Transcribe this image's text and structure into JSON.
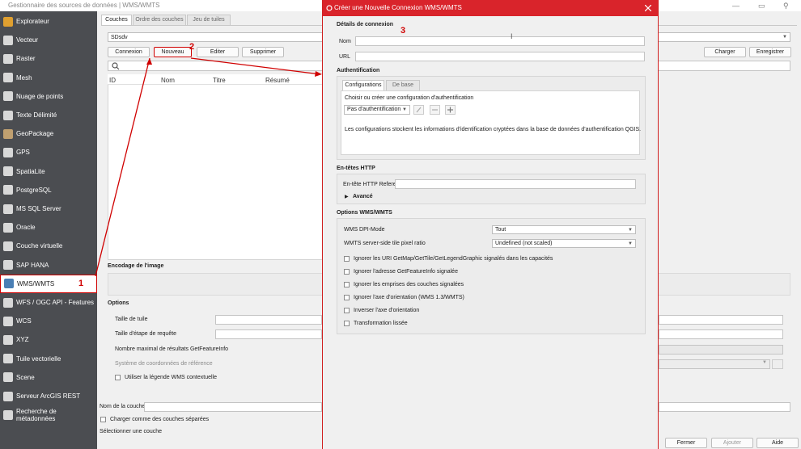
{
  "window": {
    "title": "Gestionnaire des sources de données | WMS/WMTS",
    "min": "—",
    "max": "▭",
    "pin": "⚲"
  },
  "sidebar": {
    "items": [
      {
        "label": "Explorateur",
        "icon": "folder-icon"
      },
      {
        "label": "Vecteur",
        "icon": "vector-icon"
      },
      {
        "label": "Raster",
        "icon": "raster-icon"
      },
      {
        "label": "Mesh",
        "icon": "mesh-icon"
      },
      {
        "label": "Nuage de points",
        "icon": "point-cloud-icon"
      },
      {
        "label": "Texte Délimité",
        "icon": "delimited-text-icon"
      },
      {
        "label": "GeoPackage",
        "icon": "geopackage-icon"
      },
      {
        "label": "GPS",
        "icon": "gps-icon"
      },
      {
        "label": "SpatiaLite",
        "icon": "spatialite-icon"
      },
      {
        "label": "PostgreSQL",
        "icon": "postgresql-icon"
      },
      {
        "label": "MS SQL Server",
        "icon": "mssql-icon"
      },
      {
        "label": "Oracle",
        "icon": "oracle-icon"
      },
      {
        "label": "Couche virtuelle",
        "icon": "virtual-layer-icon"
      },
      {
        "label": "SAP HANA",
        "icon": "sap-hana-icon"
      },
      {
        "label": "WMS/WMTS",
        "icon": "wms-icon"
      },
      {
        "label": "WFS / OGC API - Features",
        "icon": "wfs-icon"
      },
      {
        "label": "WCS",
        "icon": "wcs-icon"
      },
      {
        "label": "XYZ",
        "icon": "xyz-icon"
      },
      {
        "label": "Tuile vectorielle",
        "icon": "vector-tile-icon"
      },
      {
        "label": "Scene",
        "icon": "scene-icon"
      },
      {
        "label": "Serveur ArcGIS REST",
        "icon": "arcgis-icon"
      },
      {
        "label": "Recherche de métadonnées",
        "icon": "metadata-search-icon"
      }
    ]
  },
  "main": {
    "tabs": [
      "Couches",
      "Ordre des couches",
      "Jeu de tuiles"
    ],
    "connection_value": "SDsdv",
    "buttons": {
      "connexion": "Connexion",
      "nouveau": "Nouveau",
      "editer": "Editer",
      "supprimer": "Supprimer",
      "charger": "Charger",
      "enregistrer": "Enregistrer"
    },
    "columns": [
      "ID",
      "Nom",
      "Titre",
      "Résumé"
    ],
    "encoding_header": "Encodage de l'image",
    "options_header": "Options",
    "options": {
      "tile_size": "Taille de tuile",
      "step_size": "Taille d'étape de requête",
      "max_results": "Nombre maximal de résultats GetFeatureInfo",
      "crs": "Système de coordonnées de référence",
      "contextual_legend": "Utiliser la légende WMS contextuelle"
    },
    "layer_name_label": "Nom de la couche",
    "load_separate": "Charger comme des couches séparées",
    "select_layer": "Sélectionner une couche",
    "footer": {
      "fermer": "Fermer",
      "ajouter": "Ajouter",
      "aide": "Aide"
    }
  },
  "dialog": {
    "title": "Créer une Nouvelle Connexion WMS/WMTS",
    "details_header": "Détails de connexion",
    "name_label": "Nom",
    "url_label": "URL",
    "auth_header": "Authentification",
    "auth_tabs": [
      "Configurations",
      "De base"
    ],
    "auth_choose": "Choisir ou créer une configuration d'authentification",
    "auth_combo": "Pas d'authentification",
    "auth_info": "Les configurations stockent les informations d'identification cryptées dans la base de données d'authentification QGIS.",
    "http_header": "En-têtes HTTP",
    "referer_label": "En-tête HTTP Referer",
    "advanced": "Avancé",
    "wms_header": "Options WMS/WMTS",
    "dpi_label": "WMS DPI-Mode",
    "dpi_value": "Tout",
    "ratio_label": "WMTS server-side tile pixel ratio",
    "ratio_value": "Undefined (not scaled)",
    "checks": [
      "Ignorer les URI GetMap/GetTile/GetLegendGraphic signalés dans les capacités",
      "Ignorer l'adresse GetFeatureInfo signalée",
      "Ignorer les emprises des couches signalées",
      "Ignorer l'axe d'orientation (WMS 1.3/WMTS)",
      "Inverser l'axe d'orientation",
      "Transformation lissée"
    ]
  },
  "annotations": {
    "n1": "1",
    "n2": "2",
    "n3": "3"
  },
  "colors": {
    "accent": "#d9242b",
    "sidebar": "#4b4d51",
    "annotation": "#d00000"
  }
}
